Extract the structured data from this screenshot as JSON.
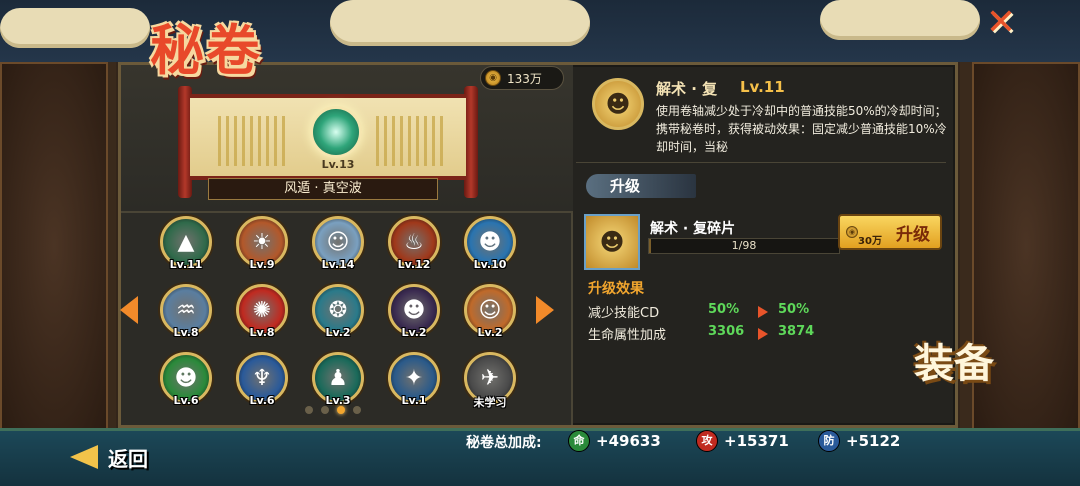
{
  "header": {
    "title": "秘卷",
    "close_icon": "close-x-icon",
    "coin_amount": "133万"
  },
  "featured_scroll": {
    "level": "Lv.13",
    "name": "风遁 · 真空波"
  },
  "skill_grid": [
    {
      "level": "Lv.11",
      "color": "#2f6a4a",
      "glyph": "▲"
    },
    {
      "level": "Lv.9",
      "color": "#b3582a",
      "glyph": "☀"
    },
    {
      "level": "Lv.14",
      "color": "#7aa0c0",
      "glyph": "☺"
    },
    {
      "level": "Lv.12",
      "color": "#a0381a",
      "glyph": "♨"
    },
    {
      "level": "Lv.10",
      "color": "#2a74b0",
      "glyph": "☻"
    },
    {
      "level": "Lv.8",
      "color": "#5a7ea0",
      "glyph": "♒"
    },
    {
      "level": "Lv.8",
      "color": "#c02a20",
      "glyph": "✺"
    },
    {
      "level": "Lv.2",
      "color": "#2a7a8a",
      "glyph": "❂"
    },
    {
      "level": "Lv.2",
      "color": "#3a2a50",
      "glyph": "☻"
    },
    {
      "level": "Lv.2",
      "color": "#c06a2a",
      "glyph": "☺"
    },
    {
      "level": "Lv.6",
      "color": "#2a8a3a",
      "glyph": "☻"
    },
    {
      "level": "Lv.6",
      "color": "#2a5a9a",
      "glyph": "♆"
    },
    {
      "level": "Lv.3",
      "color": "#1a6a5a",
      "glyph": "♟"
    },
    {
      "level": "Lv.1",
      "color": "#2a5a8a",
      "glyph": "✦"
    },
    {
      "level": "未学习",
      "color": "#4a4a4a",
      "glyph": "✈"
    }
  ],
  "detail": {
    "name": "解术 · 复",
    "level": "Lv.11",
    "description": "使用卷轴减少处于冷却中的普通技能50%的冷却时间；携带秘卷时，获得被动效果：固定减少普通技能10%冷却时间，当秘"
  },
  "upgrade": {
    "header": "升级",
    "fragment_name": "解术 · 复碎片",
    "fragment_progress": "1/98",
    "fragment_fraction": 0.0102,
    "cost": "30万",
    "button_label": "升级",
    "effect_title": "升级效果",
    "effects": [
      {
        "label": "减少技能CD",
        "old": "50%",
        "new": "50%"
      },
      {
        "label": "生命属性加成",
        "old": "3306",
        "new": "3874"
      }
    ]
  },
  "footer": {
    "back_label": "返回",
    "bonus_label": "秘卷总加成:",
    "bonuses": [
      {
        "badge": "命",
        "value": "+49633",
        "color": "#2a8a3a"
      },
      {
        "badge": "攻",
        "value": "+15371",
        "color": "#c02a20"
      },
      {
        "badge": "防",
        "value": "+5122",
        "color": "#2a5a9a"
      }
    ],
    "equip_badge": "装备"
  },
  "pagination": {
    "count": 4,
    "active": 2
  }
}
